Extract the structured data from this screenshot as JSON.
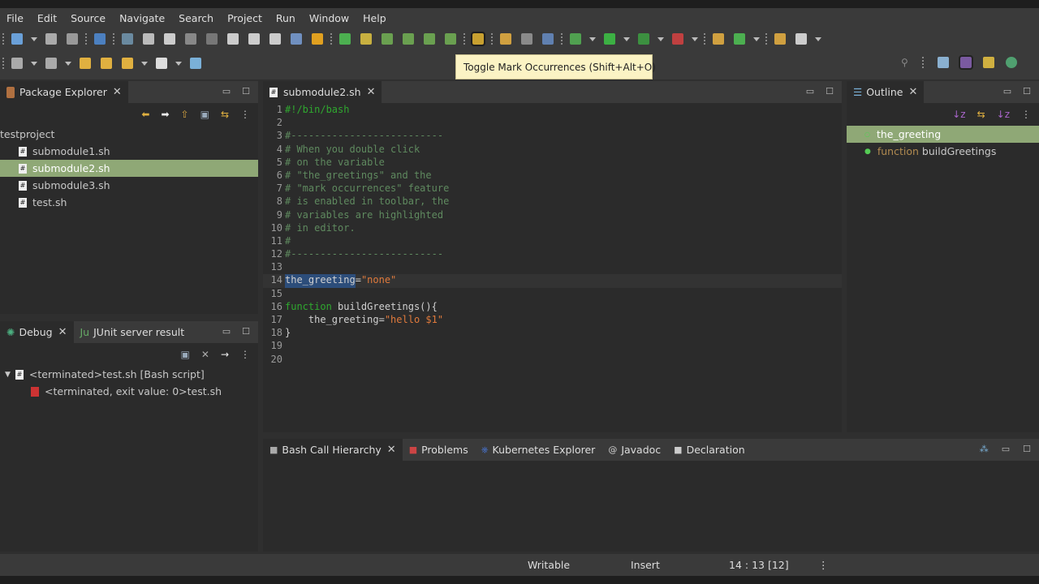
{
  "menu": [
    "File",
    "Edit",
    "Source",
    "Navigate",
    "Search",
    "Project",
    "Run",
    "Window",
    "Help"
  ],
  "toolbar1": [
    {
      "icon": "new-icon",
      "c": "#6aa0d8"
    },
    {
      "dd": 1
    },
    {
      "icon": "save-icon",
      "c": "#aaa"
    },
    {
      "icon": "save-all-icon",
      "c": "#999"
    },
    {
      "sep": 1
    },
    {
      "icon": "terminal-icon",
      "c": "#4c80c0"
    },
    {
      "sep": 1
    },
    {
      "icon": "skip-breakpoints-icon",
      "c": "#6a8aa0"
    },
    {
      "icon": "resume-icon",
      "c": "#bbb"
    },
    {
      "icon": "suspend-icon",
      "c": "#ccc"
    },
    {
      "icon": "terminate-icon",
      "c": "#888"
    },
    {
      "icon": "disconnect-icon",
      "c": "#777"
    },
    {
      "icon": "step-into-icon",
      "c": "#ccc"
    },
    {
      "icon": "step-over-icon",
      "c": "#ccc"
    },
    {
      "icon": "step-return-icon",
      "c": "#ccc"
    },
    {
      "icon": "drop-to-frame-icon",
      "c": "#7090c0"
    },
    {
      "icon": "use-step-filters-icon",
      "c": "#e0a020"
    },
    {
      "sep": 1
    },
    {
      "icon": "new-project-icon",
      "c": "#4caf50"
    },
    {
      "icon": "new-package-icon",
      "c": "#c8b040"
    },
    {
      "icon": "new-class-icon",
      "c": "#6aa050"
    },
    {
      "icon": "new-interface-icon",
      "c": "#6aa050"
    },
    {
      "icon": "new-enum-icon",
      "c": "#6aa050"
    },
    {
      "icon": "new-annotation-icon",
      "c": "#6aa050"
    },
    {
      "sep": 1
    },
    {
      "icon": "toggle-mark-occurrences-icon",
      "c": "#c8a030",
      "active": 1
    },
    {
      "sep": 1
    },
    {
      "icon": "open-type-icon",
      "c": "#d0a040"
    },
    {
      "icon": "open-task-icon",
      "c": "#8a8a8a"
    },
    {
      "icon": "show-whitespace-icon",
      "c": "#6080b0"
    },
    {
      "sep": 1
    },
    {
      "icon": "debug-icon",
      "c": "#50a050"
    },
    {
      "dd": 1
    },
    {
      "icon": "run-icon",
      "c": "#3cb043"
    },
    {
      "dd": 1
    },
    {
      "icon": "coverage-icon",
      "c": "#3c9040"
    },
    {
      "dd": 1
    },
    {
      "icon": "external-tools-icon",
      "c": "#c04040"
    },
    {
      "dd": 1
    },
    {
      "sep": 1
    },
    {
      "icon": "new-java-class-icon",
      "c": "#d0a040"
    },
    {
      "icon": "new-server-icon",
      "c": "#4caf50"
    },
    {
      "dd": 1
    },
    {
      "sep": 1
    },
    {
      "icon": "open-folder-icon",
      "c": "#d0a040"
    },
    {
      "icon": "pen-icon",
      "c": "#ccc"
    },
    {
      "dd": 1
    }
  ],
  "toolbar2": [
    {
      "icon": "next-annotation-icon",
      "c": "#aaa"
    },
    {
      "dd": 1
    },
    {
      "icon": "previous-annotation-icon",
      "c": "#aaa"
    },
    {
      "dd": 1
    },
    {
      "icon": "last-edit-location-icon",
      "c": "#e0b040"
    },
    {
      "icon": "next-edit-location-icon",
      "c": "#e0b040"
    },
    {
      "icon": "back-icon",
      "c": "#e0b040"
    },
    {
      "dd": 1
    },
    {
      "icon": "forward-icon",
      "c": "#ddd"
    },
    {
      "dd": 1
    },
    {
      "icon": "open-perspective-icon",
      "c": "#7ab0d8"
    }
  ],
  "tooltip": "Toggle Mark Occurrences (Shift+Alt+O)",
  "package_explorer": {
    "title": "Package Explorer",
    "project": "testproject",
    "files": [
      "submodule1.sh",
      "submodule2.sh",
      "submodule3.sh",
      "test.sh"
    ],
    "selected": 1
  },
  "debug": {
    "tabs": [
      "Debug",
      "JUnit server result"
    ],
    "items": [
      "<terminated>test.sh [Bash script]",
      "<terminated, exit value: 0>test.sh"
    ]
  },
  "editor": {
    "tab": "submodule2.sh",
    "lines": [
      [
        [
          "#!/bin/bash",
          "kw"
        ]
      ],
      [],
      [
        [
          "#--------------------------",
          "cm"
        ]
      ],
      [
        [
          "# When you double click",
          "cm"
        ]
      ],
      [
        [
          "# on the variable",
          "cm"
        ]
      ],
      [
        [
          "# \"the_greetings\" and the",
          "cm"
        ]
      ],
      [
        [
          "# \"mark occurrences\" feature",
          "cm"
        ]
      ],
      [
        [
          "# is enabled in toolbar, the",
          "cm"
        ]
      ],
      [
        [
          "# variables are highlighted",
          "cm"
        ]
      ],
      [
        [
          "# in editor.",
          "cm"
        ]
      ],
      [
        [
          "#",
          "cm"
        ]
      ],
      [
        [
          "#--------------------------",
          "cm"
        ]
      ],
      [],
      [
        [
          "the_greeting",
          "hl"
        ],
        [
          "=",
          ""
        ],
        [
          "\"none\"",
          "st"
        ]
      ],
      [],
      [
        [
          "function",
          "kw"
        ],
        [
          " buildGreetings(){",
          ""
        ]
      ],
      [
        [
          "    the_greeting=",
          ""
        ],
        [
          "\"hello $1\"",
          "st"
        ]
      ],
      [
        [
          "}",
          ""
        ]
      ],
      [],
      []
    ]
  },
  "outline": {
    "title": "Outline",
    "items": [
      {
        "label": "the_greeting"
      },
      {
        "kw": "function",
        "label": "buildGreetings"
      }
    ]
  },
  "bottom_tabs": [
    "Bash Call Hierarchy",
    "Problems",
    "Kubernetes Explorer",
    "Javadoc",
    "Declaration"
  ],
  "status": {
    "writable": "Writable",
    "mode": "Insert",
    "position": "14 : 13 [12]"
  }
}
